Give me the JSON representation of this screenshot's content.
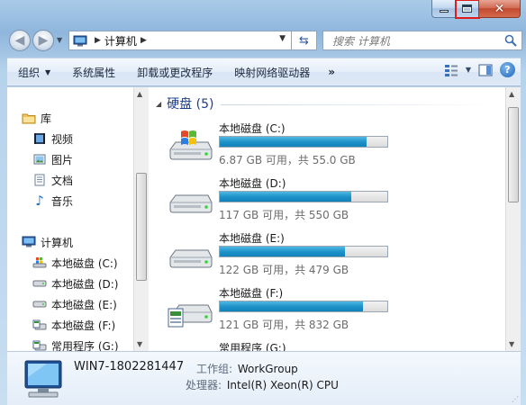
{
  "window": {
    "controls": {
      "minimize": "minimize",
      "maximize": "maximize",
      "close": "close"
    }
  },
  "address": {
    "crumbs": [
      "计算机"
    ],
    "search_placeholder": "搜索 计算机"
  },
  "toolbar": {
    "organize": "组织",
    "system_properties": "系统属性",
    "uninstall": "卸载或更改程序",
    "map_drive": "映射网络驱动器",
    "more": "»"
  },
  "nav": {
    "library": "库",
    "videos": "视频",
    "pictures": "图片",
    "documents": "文档",
    "music": "音乐",
    "computer": "计算机",
    "drives": [
      "本地磁盘 (C:)",
      "本地磁盘 (D:)",
      "本地磁盘 (E:)",
      "本地磁盘 (F:)",
      "常用程序 (G:)"
    ]
  },
  "main": {
    "group_label": "硬盘 (5)",
    "drives": [
      {
        "name": "本地磁盘 (C:)",
        "info": "6.87 GB 可用，共 55.0 GB",
        "used_fraction": 0.875,
        "icon": "windows-drive-icon"
      },
      {
        "name": "本地磁盘 (D:)",
        "info": "117 GB 可用，共 550 GB",
        "used_fraction": 0.787,
        "icon": "hard-drive-icon"
      },
      {
        "name": "本地磁盘 (E:)",
        "info": "122 GB 可用，共 479 GB",
        "used_fraction": 0.745,
        "icon": "hard-drive-icon"
      },
      {
        "name": "本地磁盘 (F:)",
        "info": "121 GB 可用，共 832 GB",
        "used_fraction": 0.855,
        "icon": "hard-drive-icon"
      },
      {
        "name": "常用程序 (G:)",
        "info": "",
        "used_fraction": null,
        "icon": "hard-drive-icon"
      }
    ]
  },
  "details": {
    "pc_name": "WIN7-1802281447",
    "workgroup_label": "工作组:",
    "workgroup_value": "WorkGroup",
    "cpu_label": "处理器:",
    "cpu_value": "Intel(R) Xeon(R) CPU"
  },
  "colors": {
    "accent": "#1e3f87",
    "bar_fill": "#1f93c9",
    "max_highlight": "#e01b1b"
  }
}
